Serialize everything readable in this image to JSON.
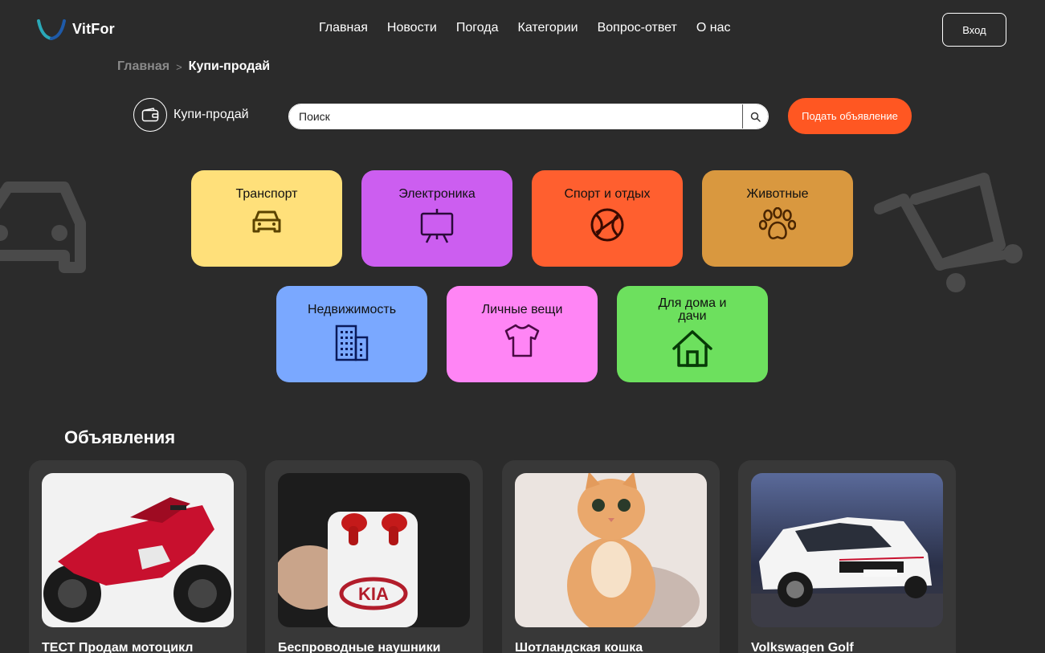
{
  "header": {
    "logo_text": "VitFor",
    "nav": [
      "Главная",
      "Новости",
      "Погода",
      "Категории",
      "Вопрос-ответ",
      "О нас"
    ],
    "login_label": "Вход"
  },
  "breadcrumb": {
    "home": "Главная",
    "separator": ">",
    "current": "Купи-продай"
  },
  "section": {
    "title": "Купи-продай",
    "icon": "wallet-icon"
  },
  "search": {
    "placeholder": "Поиск",
    "icon": "search-icon"
  },
  "post_button_label": "Подать объявление",
  "categories": [
    {
      "label": "Транспорт",
      "icon": "car-icon",
      "color": "#ffe07a"
    },
    {
      "label": "Электроника",
      "icon": "easel-icon",
      "color": "#cc5ef0"
    },
    {
      "label": "Спорт и отдых",
      "icon": "ball-icon",
      "color": "#ff5f2f"
    },
    {
      "label": "Животные",
      "icon": "paw-icon",
      "color": "#d9983f"
    },
    {
      "label": "Недвижимость",
      "icon": "building-icon",
      "color": "#7aa8ff"
    },
    {
      "label": "Личные вещи",
      "icon": "tshirt-icon",
      "color": "#ff85f5"
    },
    {
      "label": "Для дома и дачи",
      "icon": "house-icon",
      "color": "#6de05e"
    }
  ],
  "ads_title": "Объявления",
  "ads": [
    {
      "title": "ТЕСТ Продам мотоцикл",
      "image": "motorcycle-photo"
    },
    {
      "title": "Беспроводные наушники",
      "image": "earbuds-photo"
    },
    {
      "title": "Шотландская кошка",
      "image": "cat-photo"
    },
    {
      "title": "Volkswagen Golf",
      "image": "car-photo"
    }
  ],
  "colors": {
    "background": "#2b2b2b",
    "card": "#383838",
    "accent": "#ff5722"
  }
}
